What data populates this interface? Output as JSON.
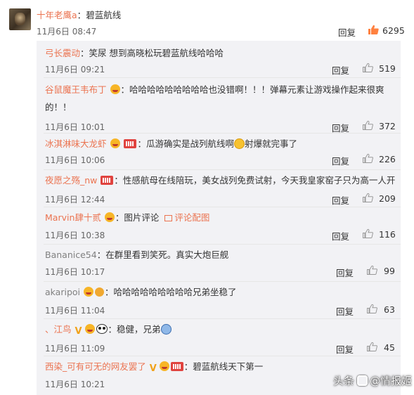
{
  "top_comment": {
    "username": "十年老鹰a",
    "colon": "：",
    "text": "碧蓝航线",
    "time": "11月6日 08:47",
    "reply_label": "回复",
    "likes": "6295"
  },
  "replies": [
    {
      "username": "弓长震动",
      "username_color": "orange",
      "badges": [],
      "text": "笑尿 想到高晓松玩碧蓝航线哈哈哈",
      "time": "11月6日 09:21",
      "reply_label": "回复",
      "likes": "519"
    },
    {
      "username": "谷鼠魔王韦布丁",
      "username_color": "orange",
      "badges": [
        "face-badge"
      ],
      "text": "哈哈哈哈哈哈哈哈哈也没错啊！！！弹幕元素让游戏操作起来很爽",
      "text_line2": "的！！",
      "time": "11月6日 10:01",
      "reply_label": "回复",
      "likes": "372"
    },
    {
      "username": "冰淇淋味大龙虾",
      "username_color": "orange",
      "badges": [
        "face-badge",
        "vip-badge"
      ],
      "text": "瓜游确实是战列航线啊",
      "text_after_emoji": "射爆就完事了",
      "time": "11月6日 10:06",
      "reply_label": "回复",
      "likes": "226"
    },
    {
      "username": "夜愿之殇_nw",
      "username_color": "orange",
      "badges": [
        "vip-badge"
      ],
      "text": "性感航母在线陪玩，美女战列免费试射，今天我皇家窑子只为高一人开",
      "time": "11月6日 12:44",
      "reply_label": "回复",
      "likes": "209"
    },
    {
      "username": "Marvin肆十贰",
      "username_color": "orange",
      "badges": [
        "face-badge"
      ],
      "text": "图片评论",
      "pic_link": "评论配图",
      "time": "11月6日 10:38",
      "reply_label": "回复",
      "likes": "116"
    },
    {
      "username": "Bananice54",
      "username_color": "gray",
      "badges": [],
      "text": "在群里看到笑死。真实大炮巨舰",
      "time": "11月6日 10:17",
      "reply_label": "回复",
      "likes": "99"
    },
    {
      "username": "akaripoi",
      "username_color": "gray",
      "badges": [
        "face-badge",
        "crown-badge"
      ],
      "text": "哈哈哈哈哈哈哈哈哈兄弟坐稳了",
      "time": "11月6日 11:04",
      "reply_label": "回复",
      "likes": "63"
    },
    {
      "username": "、江鸟",
      "username_color": "orange",
      "badges": [
        "v-badge",
        "face-badge",
        "panda-badge"
      ],
      "text": "稳健，兄弟",
      "time": "11月6日 11:09",
      "reply_label": "回复",
      "likes": "45"
    },
    {
      "username": "西染_可有可无的网友罢了",
      "username_color": "orange",
      "badges": [
        "v-badge",
        "face-badge",
        "vip-badge"
      ],
      "text": "碧蓝航线天下第一",
      "time": "11月6日 10:21",
      "reply_label": "",
      "likes": ""
    }
  ],
  "watermark": {
    "prefix": "头条",
    "handle": "@情报姬"
  },
  "colors": {
    "username_orange": "#eb7350",
    "username_gray": "#808080",
    "reply_bg": "#f2f2f5",
    "like_icon": "#ff8140"
  }
}
